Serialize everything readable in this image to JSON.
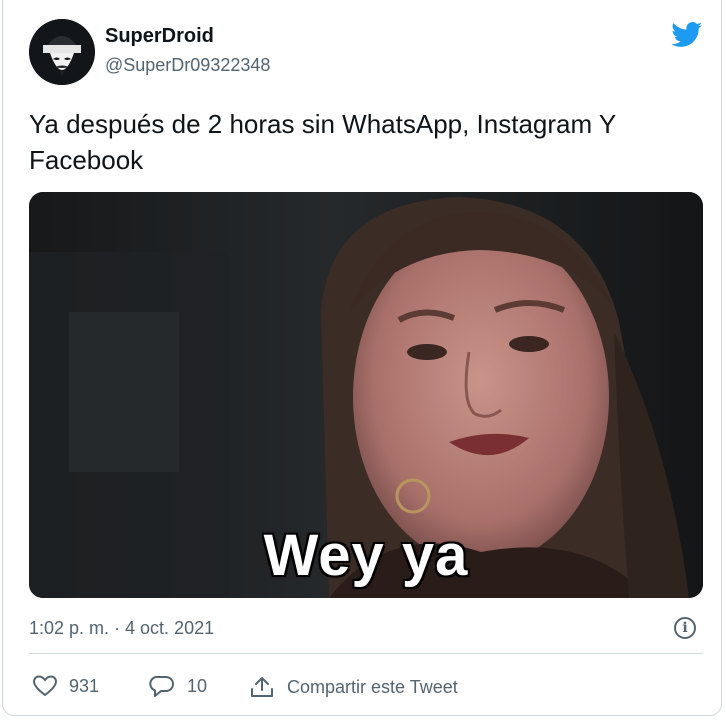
{
  "tweet": {
    "display_name": "SuperDroid",
    "handle": "@SuperDr09322348",
    "text": "Ya después de 2 horas sin WhatsApp, Instagram Y Facebook",
    "media_caption": "Wey ya",
    "timestamp": "1:02 p. m. · 4 oct. 2021",
    "info_glyph": "i"
  },
  "actions": {
    "likes": "931",
    "replies": "10",
    "share_label": "Compartir este Tweet"
  },
  "colors": {
    "brand_blue": "#1d9bf0",
    "text_primary": "#0f1419",
    "text_secondary": "#536471",
    "border": "#cfd9de"
  },
  "icons": [
    "avatar-mask-icon",
    "twitter-bird-icon",
    "info-icon",
    "heart-icon",
    "reply-bubble-icon",
    "share-icon"
  ]
}
